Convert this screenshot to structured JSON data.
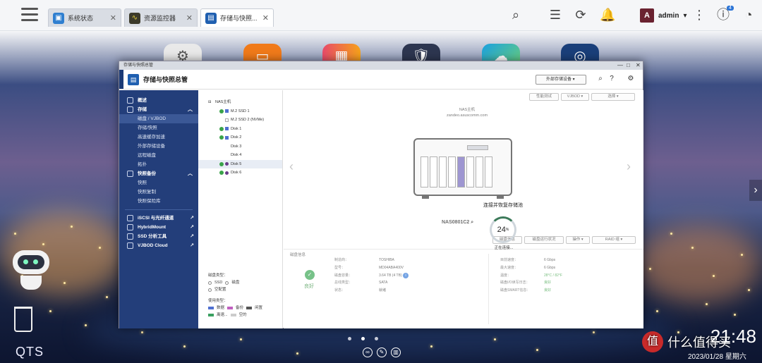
{
  "topbar": {
    "tabs": [
      {
        "label": "系统状态",
        "icon": "system-status-icon"
      },
      {
        "label": "资源监控器",
        "icon": "resource-monitor-icon"
      },
      {
        "label": "存储与快照...",
        "icon": "storage-icon"
      }
    ],
    "user": "admin",
    "notification_badge": "4"
  },
  "desktop": {
    "apps": [
      {
        "name": "settings-app-icon",
        "color": "#e9e9e9"
      },
      {
        "name": "file-station-app-icon",
        "color": "#f07a1a"
      },
      {
        "name": "app-center-icon",
        "color": "#e84a6a"
      },
      {
        "name": "security-app-icon",
        "color": "#2d3650"
      },
      {
        "name": "cloud-app-icon",
        "color": "#1aa0e0"
      },
      {
        "name": "helpdesk-app-icon",
        "color": "#1a3f7a"
      }
    ],
    "qts_label": "QTS",
    "clock": "21:48",
    "date": "2023/01/28 星期六",
    "watermark": "什么值得买",
    "watermark_logo": "值"
  },
  "window": {
    "title": "存储与快照总管",
    "header_title": "存储与快照总管",
    "external_storage_btn": "外部存储设备",
    "sidebar": {
      "overview": "概述",
      "storage": "存储",
      "storage_items": [
        "磁盘 / VJBOD",
        "存储/快照",
        "高速缓存加速",
        "外部存储设备",
        "远程磁盘",
        "拓扑"
      ],
      "snapshot_backup": "快照备份",
      "snapshot_items": [
        "快照",
        "快照复制",
        "快照保险库"
      ],
      "tools": [
        "iSCSI 与光纤通道",
        "HybridMount",
        "SSD 分析工具",
        "VJBOD Cloud"
      ]
    },
    "tree": {
      "root": "NAS主机",
      "items": [
        "M.2 SSD 1",
        "M.2 SSD 2 (NVMe)",
        "Disk 1",
        "Disk 2",
        "Disk 3",
        "Disk 4",
        "Disk 5",
        "Disk 6"
      ],
      "disk_type_label": "磁盘类型：",
      "ssd": "SSD",
      "hdd": "磁盘",
      "free": "空配置",
      "usage_label": "使用类型：",
      "data": "数据",
      "spare": "备份",
      "cache": "闲置",
      "other": "离速...",
      "none": "空的"
    },
    "main": {
      "toolbar": [
        "性能测试",
        "VJBOD",
        "选择"
      ],
      "nas_name": "NAS主机",
      "nas_host": "zandeo.asuscomm.com",
      "model": "NAS0801C2",
      "loading_title": "连接并恢复存储池",
      "progress": 24,
      "progress_unit": "%",
      "loading_sub": "正在连接...",
      "lower_buttons": [
        "磁盘信息",
        "磁盘运行状况",
        "操作",
        "RAID 组"
      ],
      "disk_info_title": "磁盘信息",
      "status": "良好",
      "left_keys": [
        "制造商：",
        "型号：",
        "磁盘容量：",
        "总线类型：",
        "状态："
      ],
      "left_vals": [
        "TOSHIBA",
        "MD04ABA400V",
        "3.64 TB (4 TB)",
        "SATA",
        "就绪"
      ],
      "right_keys": [
        "目前速度：",
        "最大速度：",
        "温度：",
        "磁盘I/O读写日志：",
        "磁盘SMART信息："
      ],
      "right_vals": [
        "6 Gbps",
        "6 Gbps",
        "28°C / 82°F",
        "良好",
        "良好"
      ]
    }
  }
}
